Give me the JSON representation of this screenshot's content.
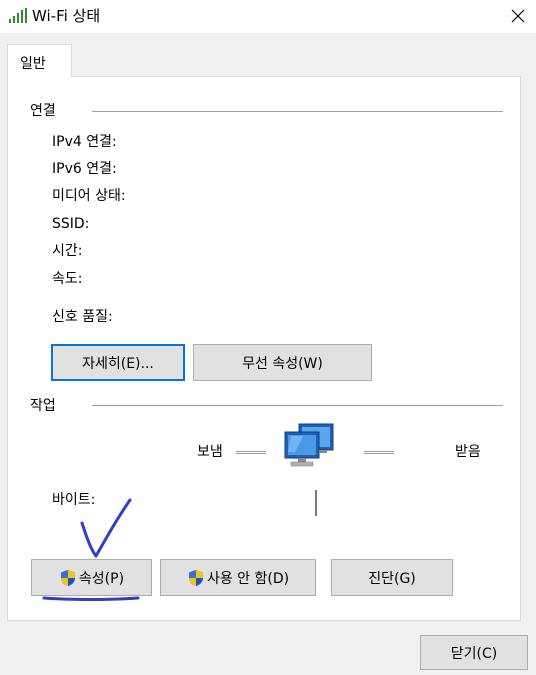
{
  "window": {
    "title": "Wi-Fi 상태",
    "icon": "wifi-signal-icon",
    "close_icon": "close-icon"
  },
  "tabs": [
    {
      "label": "일반",
      "selected": true
    }
  ],
  "connection": {
    "section_label": "연결",
    "fields": [
      {
        "label": "IPv4 연결:"
      },
      {
        "label": "IPv6 연결:"
      },
      {
        "label": "미디어 상태:"
      },
      {
        "label": "SSID:"
      },
      {
        "label": "시간:"
      },
      {
        "label": "속도:"
      }
    ],
    "signal_label": "신호 품질:",
    "details_button": "자세히(E)...",
    "wireless_button": "무선 속성(W)"
  },
  "activity": {
    "section_label": "작업",
    "sent_label": "보냄",
    "received_label": "받음",
    "bytes_label": "바이트:",
    "icon": "network-computers-icon"
  },
  "actions": {
    "properties_button": "속성(P)",
    "disable_button": "사용 안 함(D)",
    "diagnose_button": "진단(G)",
    "shield_icon": "uac-shield-icon"
  },
  "footer": {
    "close_button": "닫기(C)"
  },
  "annotation": {
    "color": "#2e3fc8",
    "marks": "checkmark-and-underline"
  }
}
